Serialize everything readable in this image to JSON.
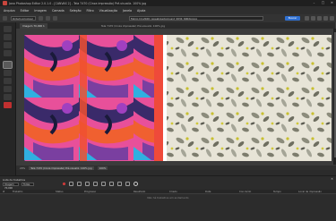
{
  "titlebar": {
    "title": "Jano Photoshop Editor 2.0.1.0 - [CANVAS 2] - Tela 7470 (Cinza impressão) Pré-visualiz. 100% jpg"
  },
  "window": {
    "minimize": "–",
    "maximize": "□",
    "close": "✕"
  },
  "menu": [
    "Arquivo",
    "Editar",
    "Imagem",
    "Camada",
    "Seleção",
    "Filtro",
    "Visualização",
    "Janela",
    "Ajuda"
  ],
  "toolbar": {
    "preset": "Ordem principal",
    "path": "Fabric-hd-2026_repeat-background_0034_600dpi.jpg",
    "search_label": "Buscar"
  },
  "document": {
    "tab_label": "Imagem 70,000 1",
    "path": "Tela 7470 (Cinza impressão) Pré-visualiz. 100% jpg"
  },
  "status": {
    "zoom": "20%",
    "doc_label": "Tela 7470 (Cinza impressão) Pré-visualiz. 100% jpg",
    "chip": "100%"
  },
  "panel": {
    "title": "Lista de trabalhos",
    "close": "✕",
    "filter_value": "Imagem 70,000",
    "scope_value": "Todas",
    "columns": [
      "#",
      "Trabalho",
      "Status",
      "Progresso",
      "Resultado",
      "Criado",
      "Data",
      "Concluído",
      "Tempo",
      "Local de impressão"
    ],
    "empty_text": "Não há trabalhos em andamento"
  },
  "icons": {
    "app": "app-icon",
    "record": "record-icon",
    "settings": "gear-icon"
  },
  "colors": {
    "accent": "#2f6fd0",
    "record": "#b02020"
  }
}
